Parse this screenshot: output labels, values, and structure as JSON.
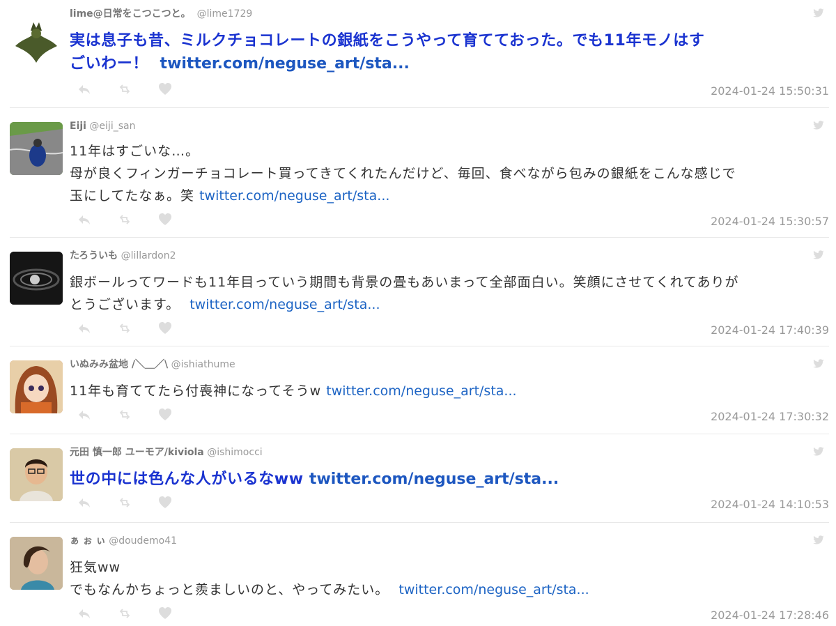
{
  "tweets": [
    {
      "name": "lime@日常をこつこつと。",
      "handle": "@lime1729",
      "lines": [
        "実は息子も昔、ミルクチョコレートの銀紙をこうやって育てておった。でも11年モノはす",
        "ごいわー！"
      ],
      "link": "twitter.com/neguse_art/sta...",
      "time": "2024-01-24 15:50:31"
    },
    {
      "name": "Eiji",
      "handle": "@eiji_san",
      "lines": [
        "11年はすごいな…。",
        "母が良くフィンガーチョコレート買ってきてくれたんだけど、毎回、食べながら包みの銀紙をこんな感じで",
        "玉にしてたなぁ。笑"
      ],
      "link": "twitter.com/neguse_art/sta...",
      "time": "2024-01-24 15:30:57"
    },
    {
      "name": "たろういも",
      "handle": "@lillardon2",
      "lines": [
        "銀ボールってワードも11年目っていう期間も背景の畳もあいまって全部面白い。笑顔にさせてくれてありが",
        "とうございます。"
      ],
      "link": "twitter.com/neguse_art/sta...",
      "time": "2024-01-24 17:40:39"
    },
    {
      "name": "いぬみみ盆地 /＼＿／\\",
      "handle": "@ishiathume",
      "lines": [
        "11年も育ててたら付喪神になってそうw"
      ],
      "link": "twitter.com/neguse_art/sta...",
      "time": "2024-01-24 17:30:32"
    },
    {
      "name": "元田 慎一郎 ユーモア/kiviola",
      "handle": "@ishimocci",
      "lines": [
        "世の中には色んな人がいるなww"
      ],
      "link": "twitter.com/neguse_art/sta...",
      "time": "2024-01-24 14:10:53"
    },
    {
      "name": "ぁ ぉ ぃ",
      "handle": "@doudemo41",
      "lines": [
        "狂気ww",
        "でもなんかちょっと羨ましいのと、やってみたい。"
      ],
      "link": "twitter.com/neguse_art/sta...",
      "time": "2024-01-24 17:28:46"
    }
  ],
  "colors": {
    "link": "#1d64c4",
    "emphasis": "#1a33d0",
    "icon": "#dddddd",
    "meta": "#999999"
  },
  "icons": [
    "twitter-bird-icon",
    "reply-icon",
    "retweet-icon",
    "like-icon"
  ]
}
